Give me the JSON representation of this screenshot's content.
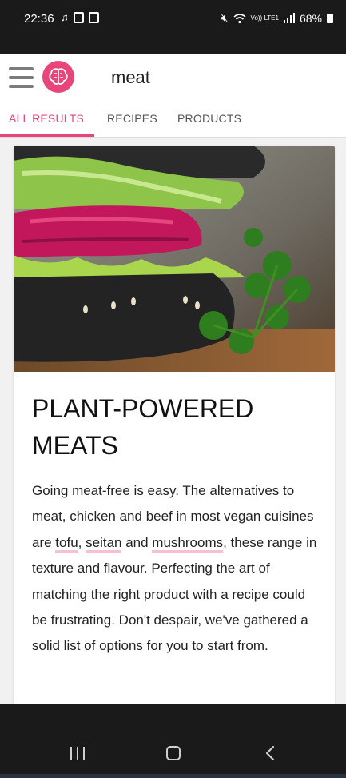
{
  "status_bar": {
    "time": "22:36",
    "network": "Vo)) LTE1",
    "battery": "68%"
  },
  "header": {
    "search_query": "meat"
  },
  "tabs": [
    {
      "label": "ALL RESULTS"
    },
    {
      "label": "RECIPES"
    },
    {
      "label": "PRODUCTS"
    }
  ],
  "article": {
    "title_line1": "PLANT-POWERED",
    "title_line2": "MEATS",
    "body_intro": "Going meat-free is easy. The alternatives to meat, chicken and beef in most vegan cuisines are ",
    "link_tofu": "tofu",
    "sep1": ", ",
    "link_seitan": "seitan",
    "sep2": " and ",
    "link_mushrooms": "mushrooms",
    "body_rest": ", these range in texture and flavour. Perfecting the art of matching the right product with a recipe could be frustrating. Don't despair, we've gathered a solid list of options for you to start from."
  },
  "colors": {
    "accent": "#e8457a",
    "link_underline": "#f4c0d2",
    "system_bar": "#1a1a1a"
  }
}
